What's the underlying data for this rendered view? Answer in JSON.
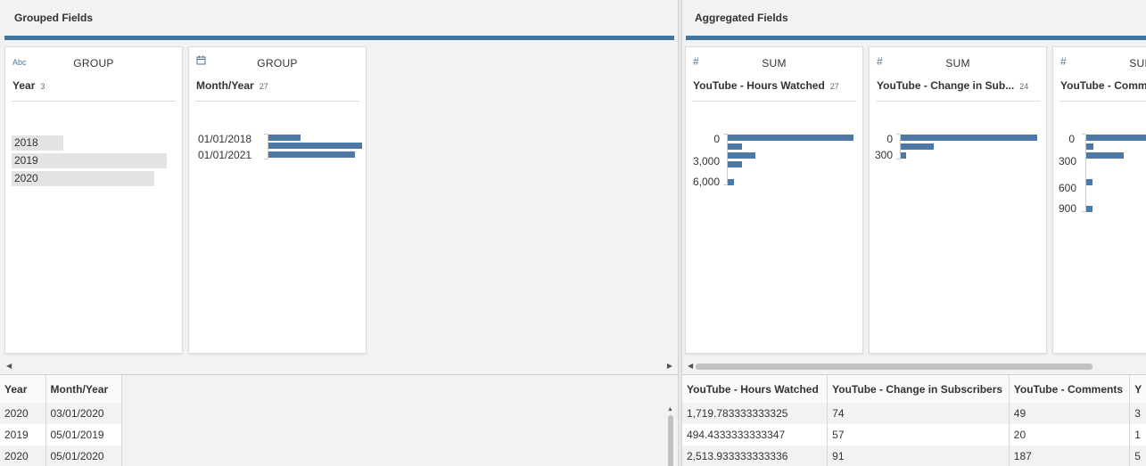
{
  "left": {
    "title": "Grouped Fields",
    "cards": [
      {
        "type": "Abc",
        "agg": "GROUP",
        "name": "Year",
        "count": "3",
        "pills": [
          {
            "label": "2018",
            "fill": 0.33
          },
          {
            "label": "2019",
            "fill": 0.99
          },
          {
            "label": "2020",
            "fill": 0.91
          }
        ]
      },
      {
        "type": "calendar-icon",
        "agg": "GROUP",
        "name": "Month/Year",
        "count": "27",
        "labels": [
          "01/01/2018",
          "01/01/2021"
        ],
        "bars": [
          0.34,
          1.0,
          0.92
        ]
      }
    ],
    "table": {
      "headers": [
        "Year",
        "Month/Year"
      ],
      "rows": [
        [
          "2020",
          "03/01/2020"
        ],
        [
          "2019",
          "05/01/2019"
        ],
        [
          "2020",
          "05/01/2020"
        ]
      ]
    }
  },
  "right": {
    "title": "Aggregated Fields",
    "cards": [
      {
        "type": "#",
        "agg": "SUM",
        "name": "YouTube - Hours Watched",
        "count": "27",
        "labels": [
          "0",
          "3,000",
          "6,000"
        ],
        "bars": [
          1.0,
          0.11,
          0.22,
          0.11,
          0.05
        ]
      },
      {
        "type": "#",
        "agg": "SUM",
        "name": "YouTube - Change in Sub...",
        "count": "24",
        "labels": [
          "0",
          "300"
        ],
        "bars": [
          1.0,
          0.24,
          0.04
        ]
      },
      {
        "type": "#",
        "agg": "SUM",
        "name": "YouTube - Comme",
        "count": "",
        "labels": [
          "0",
          "300",
          "600",
          "900"
        ],
        "bars": [
          1.0,
          0.1,
          0.52,
          0.09,
          0.09
        ]
      }
    ],
    "table": {
      "headers": [
        "YouTube - Hours Watched",
        "YouTube - Change in Subscribers",
        "YouTube - Comments",
        "Y"
      ],
      "rows": [
        [
          "1,719.783333333325",
          "74",
          "49",
          "3"
        ],
        [
          "494.4333333333347",
          "57",
          "20",
          "1"
        ],
        [
          "2,513.933333333336",
          "91",
          "187",
          "5"
        ]
      ]
    }
  },
  "colors": {
    "accent": "#4276a0",
    "bar": "#4e79a7",
    "pill": "#e3e3e3"
  }
}
